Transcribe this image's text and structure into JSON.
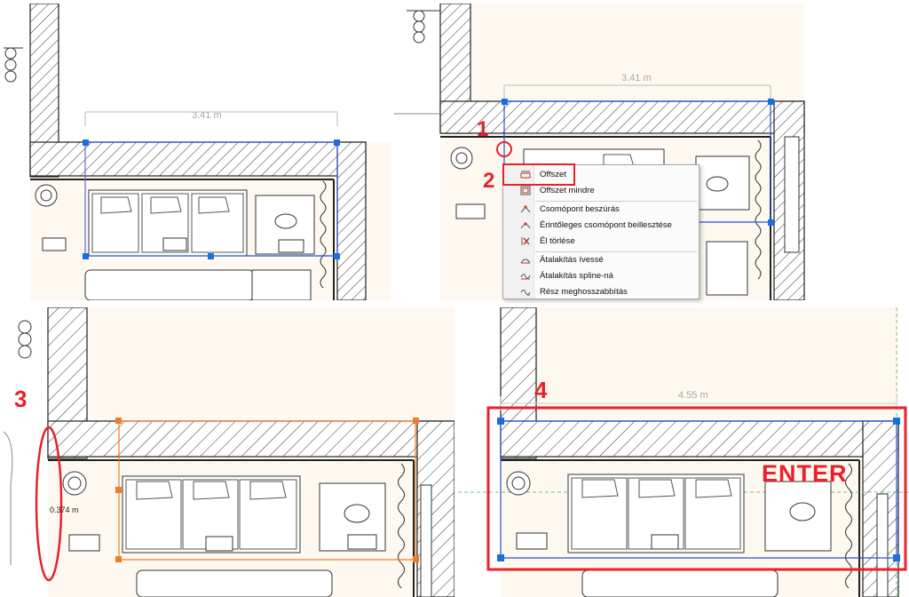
{
  "panels": {
    "top_left": {
      "dimension_label": "3.41 m"
    },
    "top_right": {
      "dimension_label": "3.41 m"
    },
    "bottom_left": {
      "offset_readout": "0.374 m"
    },
    "bottom_right": {
      "dimension_label": "4.55 m",
      "enter_label": "ENTER"
    }
  },
  "steps": [
    "1",
    "2",
    "3",
    "4"
  ],
  "context_menu": {
    "items": [
      {
        "label": "Offszet",
        "icon": "offset-icon"
      },
      {
        "label": "Offszet mindre",
        "icon": "offset-all-icon"
      },
      {
        "label": "Csomópont beszúrás",
        "icon": "insert-node-icon"
      },
      {
        "label": "Érintőleges csomópont beillesztése",
        "icon": "tangent-node-icon"
      },
      {
        "label": "Él törlése",
        "icon": "delete-edge-icon"
      },
      {
        "label": "Átalakítás ívessé",
        "icon": "arc-convert-icon"
      },
      {
        "label": "Átalakítás spline-ná",
        "icon": "spline-convert-icon"
      },
      {
        "label": "Rész meghosszabbítás",
        "icon": "extend-segment-icon"
      }
    ]
  },
  "colors": {
    "annotation_red": "#e8212b",
    "selection_blue": "#2b4fd6",
    "handle_blue": "#1a6fe0",
    "offset_orange": "#ee7d2a",
    "floor": "#fdf9f0",
    "wall_hatch": "#333333"
  }
}
